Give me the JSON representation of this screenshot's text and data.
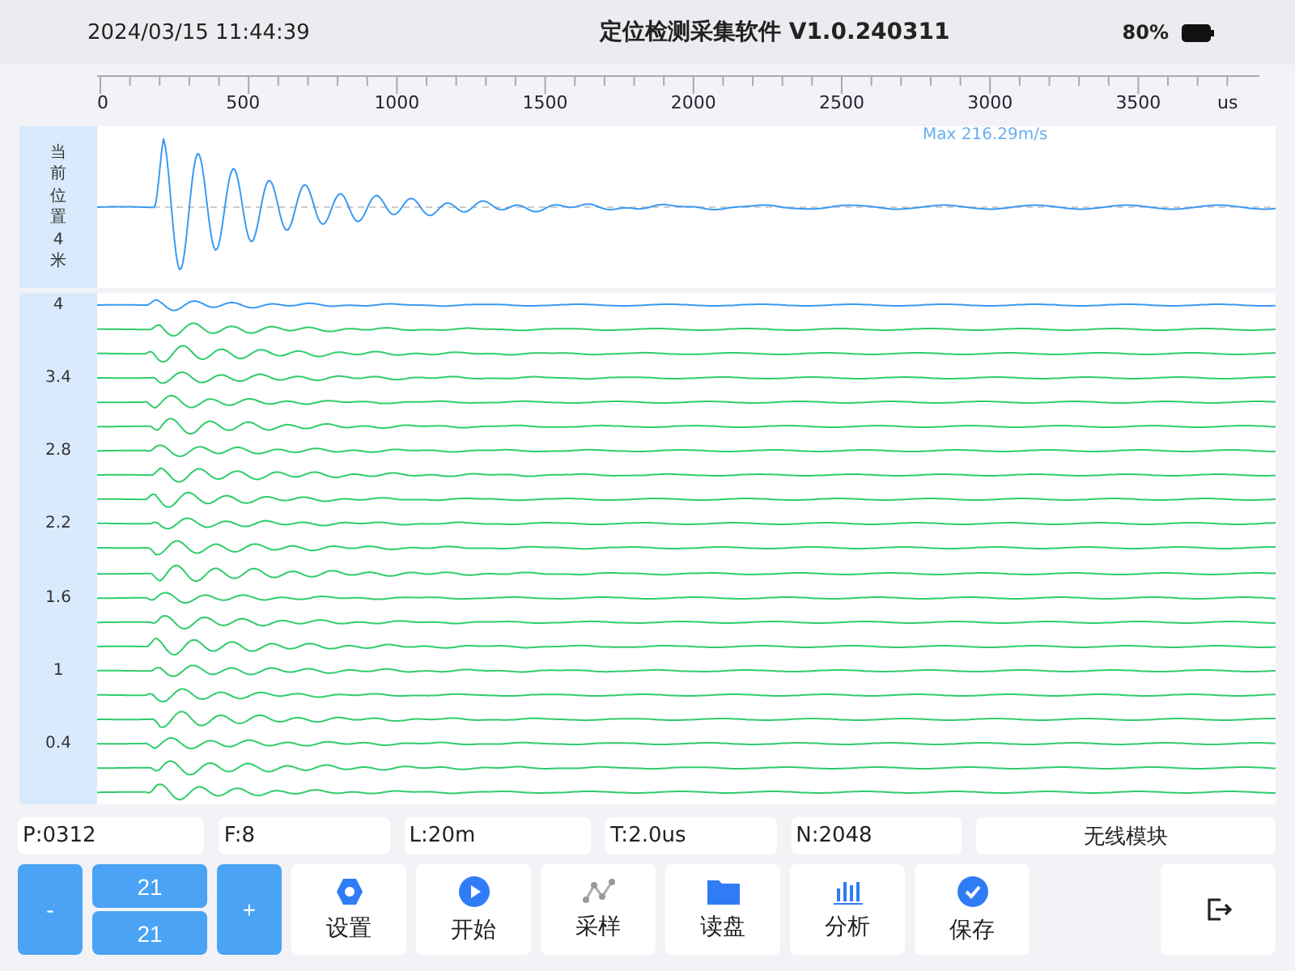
{
  "header": {
    "datetime": "2024/03/15 11:44:39",
    "title": "定位检测采集软件 V1.0.240311",
    "battery": "80%"
  },
  "axis": {
    "ticks": [
      "0",
      "500",
      "1000",
      "1500",
      "2000",
      "2500",
      "3000",
      "3500"
    ],
    "unit": "us"
  },
  "current_trace": {
    "label": "当前位置4米",
    "max": "Max 216.29m/s"
  },
  "traces": [
    {
      "label": "4",
      "color": "#3a9af0"
    },
    {
      "color": "#2fcc6b"
    },
    {
      "color": "#2fcc6b"
    },
    {
      "label": "3.4",
      "color": "#2fcc6b"
    },
    {
      "color": "#2fcc6b"
    },
    {
      "color": "#2fcc6b"
    },
    {
      "label": "2.8",
      "color": "#2fcc6b"
    },
    {
      "color": "#2fcc6b"
    },
    {
      "color": "#2fcc6b"
    },
    {
      "label": "2.2",
      "color": "#2fcc6b"
    },
    {
      "color": "#2fcc6b"
    },
    {
      "color": "#2fcc6b"
    },
    {
      "label": "1.6",
      "color": "#2fcc6b"
    },
    {
      "color": "#2fcc6b"
    },
    {
      "color": "#2fcc6b"
    },
    {
      "label": "1",
      "color": "#2fcc6b"
    },
    {
      "color": "#2fcc6b"
    },
    {
      "color": "#2fcc6b"
    },
    {
      "label": "0.4",
      "color": "#2fcc6b"
    },
    {
      "color": "#2fcc6b"
    },
    {
      "color": "#2fcc6b"
    }
  ],
  "info_fields": [
    {
      "text": "P:0312"
    },
    {
      "text": "F:8"
    },
    {
      "text": "L:20m"
    },
    {
      "text": "T:2.0us"
    },
    {
      "text": "N:2048"
    },
    {
      "text": "无线模块",
      "kind": "centered"
    }
  ],
  "counter": {
    "minus": "-",
    "values": [
      "21",
      "21"
    ],
    "plus": "+"
  },
  "tools": [
    {
      "label": "设置"
    },
    {
      "label": "开始"
    },
    {
      "label": "采样"
    },
    {
      "label": "读盘"
    },
    {
      "label": "分析"
    },
    {
      "label": "保存"
    }
  ]
}
